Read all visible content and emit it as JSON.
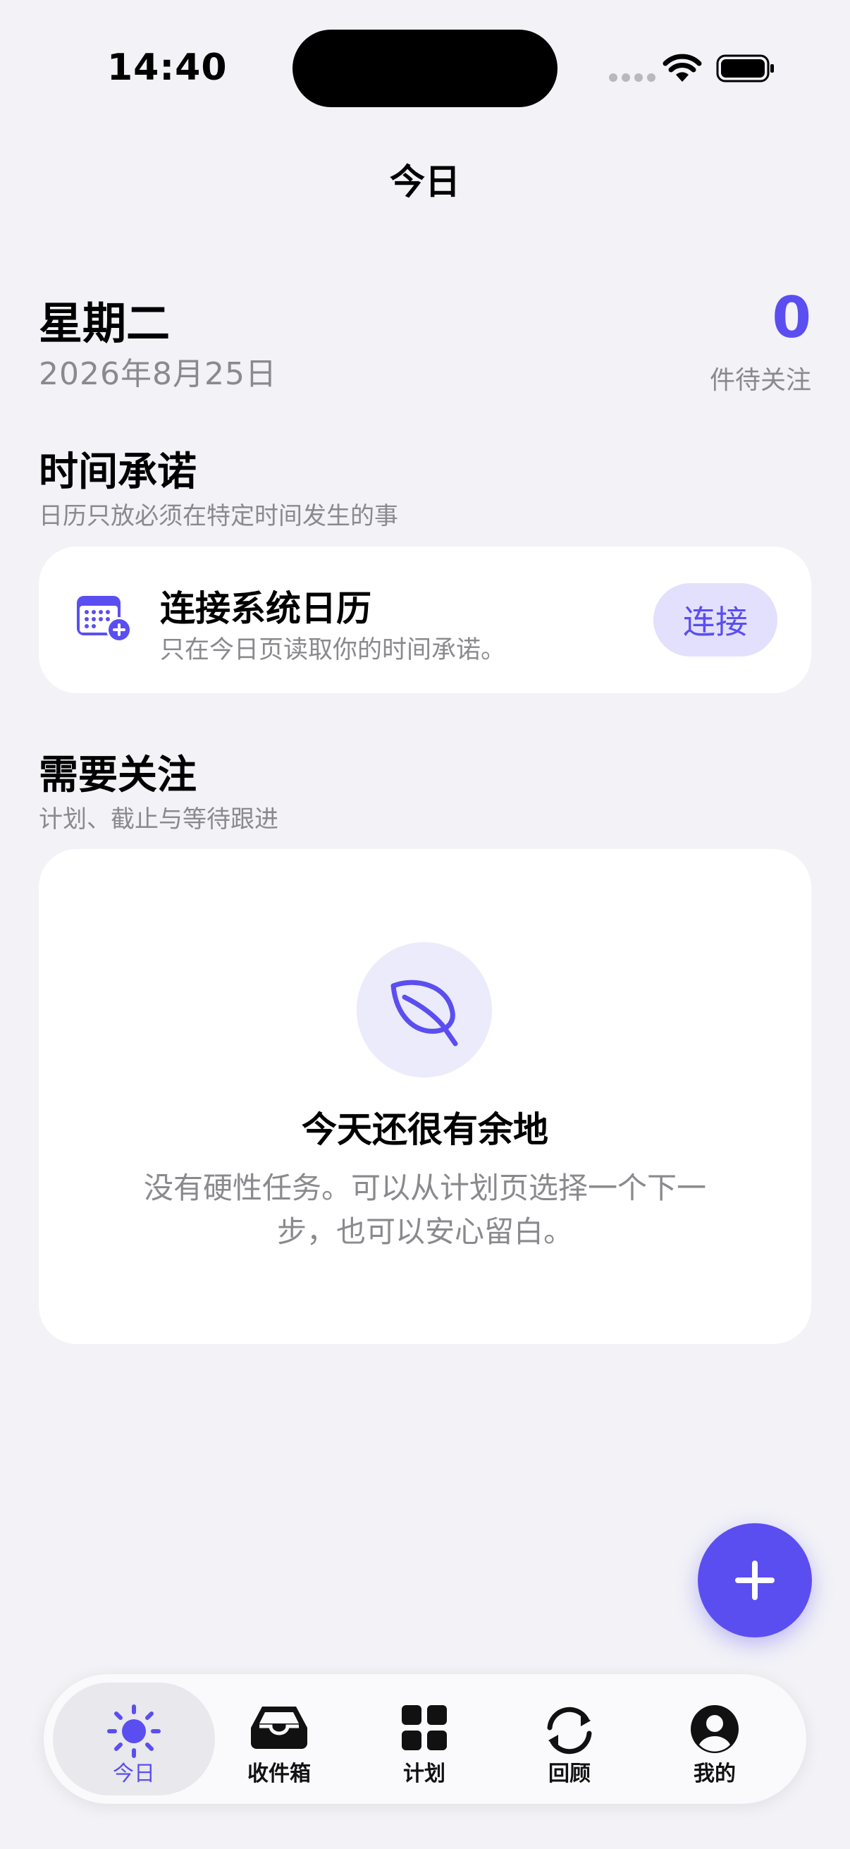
{
  "status_bar": {
    "time": "14:40"
  },
  "nav": {
    "title": "今日"
  },
  "header": {
    "weekday": "星期二",
    "date": "2026年8月25日",
    "count": "0",
    "count_label": "件待关注"
  },
  "time_commitments": {
    "title": "时间承诺",
    "subtitle": "日历只放必须在特定时间发生的事",
    "calendar_card": {
      "title": "连接系统日历",
      "subtitle": "只在今日页读取你的时间承诺。",
      "button_label": "连接",
      "icon": "calendar-plus-icon"
    }
  },
  "attention": {
    "title": "需要关注",
    "subtitle": "计划、截止与等待跟进",
    "empty_state": {
      "icon": "leaf-icon",
      "title": "今天还很有余地",
      "description": "没有硬性任务。可以从计划页选择一个下一步，也可以安心留白。"
    }
  },
  "fab": {
    "icon": "plus-icon"
  },
  "tabbar": {
    "items": [
      {
        "label": "今日",
        "icon": "sun-icon",
        "active": true
      },
      {
        "label": "收件箱",
        "icon": "inbox-icon",
        "active": false
      },
      {
        "label": "计划",
        "icon": "grid-icon",
        "active": false
      },
      {
        "label": "回顾",
        "icon": "refresh-icon",
        "active": false
      },
      {
        "label": "我的",
        "icon": "profile-icon",
        "active": false
      }
    ]
  },
  "colors": {
    "accent": "#5b4ef0",
    "accent_soft": "#e3e0fd",
    "background": "#f2f2f7",
    "secondary_text": "#8a8a8e"
  }
}
